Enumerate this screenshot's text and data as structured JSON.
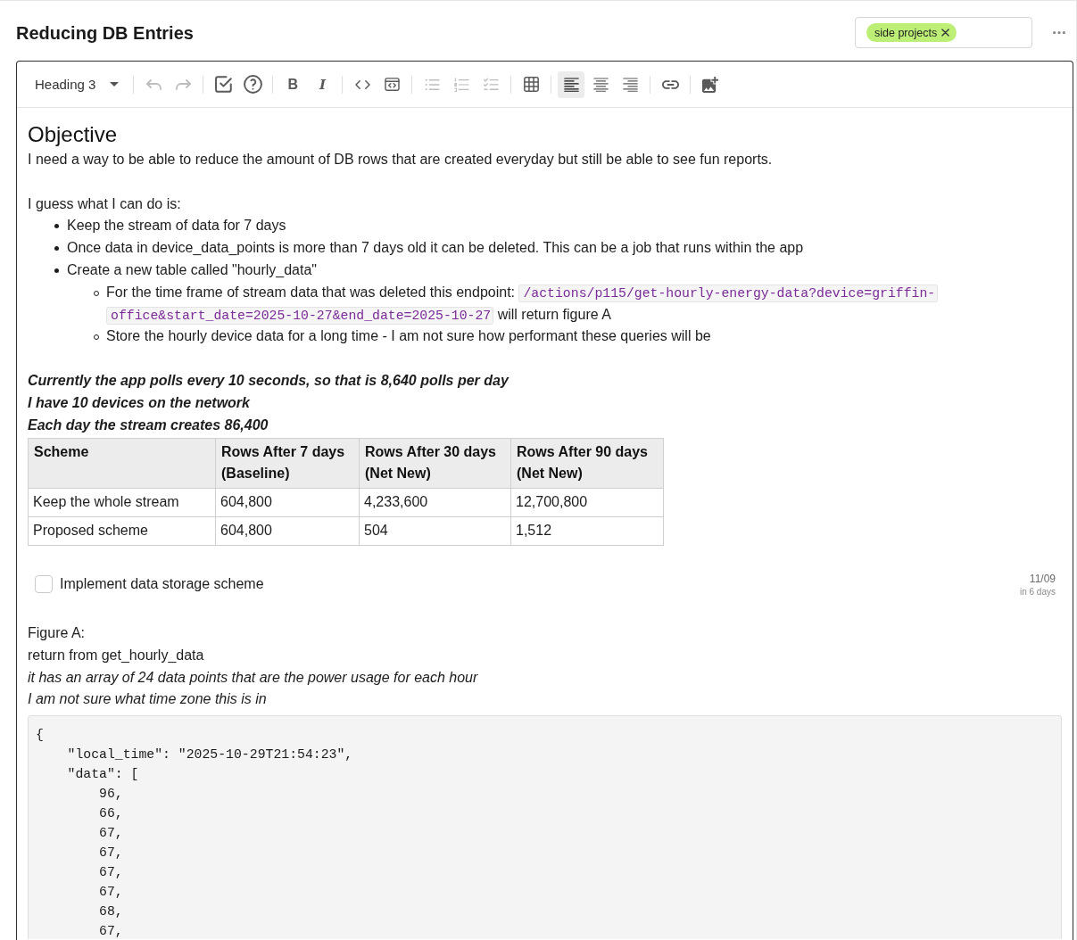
{
  "header": {
    "title": "Reducing DB Entries",
    "tags": [
      {
        "label": "side projects"
      }
    ]
  },
  "toolbar": {
    "block_style": "Heading 3",
    "groups": [
      [
        {
          "kind": "undo",
          "disabled": true
        },
        {
          "kind": "redo",
          "disabled": true
        }
      ],
      [
        {
          "kind": "task",
          "disabled": false
        },
        {
          "kind": "help",
          "disabled": false
        }
      ],
      [
        {
          "kind": "bold",
          "glyph": "B",
          "disabled": false
        },
        {
          "kind": "italic",
          "glyph": "I",
          "disabled": false
        }
      ],
      [
        {
          "kind": "code",
          "disabled": false
        },
        {
          "kind": "code_block",
          "disabled": false
        }
      ],
      [
        {
          "kind": "bullet_list",
          "disabled": true
        },
        {
          "kind": "numbered_list",
          "disabled": true
        },
        {
          "kind": "check_list",
          "disabled": true
        }
      ],
      [
        {
          "kind": "table",
          "disabled": false
        }
      ],
      [
        {
          "kind": "align_left",
          "disabled": false,
          "selected": true
        },
        {
          "kind": "align_center",
          "disabled": false,
          "selected": false
        },
        {
          "kind": "align_right",
          "disabled": false,
          "selected": false
        }
      ],
      [
        {
          "kind": "link",
          "disabled": false
        }
      ],
      [
        {
          "kind": "image",
          "disabled": false
        }
      ]
    ]
  },
  "document": {
    "sections": [
      [
        {
          "kind": "heading",
          "text": "Objective"
        },
        {
          "kind": "paragraph",
          "text": "I need a way to be able to reduce the amount of DB rows that are created everyday but still be able to see fun reports."
        }
      ],
      [
        {
          "kind": "paragraph",
          "text": "I guess what I can do is:"
        },
        {
          "kind": "list",
          "items": [
            {
              "parts": [
                {
                  "kind": "text",
                  "text": "Keep the stream of data for 7 days"
                }
              ]
            },
            {
              "parts": [
                {
                  "kind": "text",
                  "text": "Once data in device_data_points is more than 7 days old it can be deleted. This can be a job that runs within the app"
                }
              ]
            },
            {
              "parts": [
                {
                  "kind": "text",
                  "text": "Create a new table called \"hourly_data\""
                }
              ],
              "children": [
                {
                  "parts": [
                    {
                      "kind": "text",
                      "text": "For the time frame of stream data that was deleted this endpoint:"
                    },
                    {
                      "kind": "code",
                      "text": "/actions/p115/get-hourly-energy-data?device=griffin-"
                    },
                    {
                      "kind": "code",
                      "text": "office&start_date=2025-10-27&end_date=2025-10-27"
                    },
                    {
                      "kind": "text",
                      "text": "will return figure A"
                    }
                  ]
                },
                {
                  "parts": [
                    {
                      "kind": "text",
                      "text": "Store the hourly device data for a long time - I am not sure how performant these queries will be"
                    }
                  ]
                }
              ]
            }
          ]
        }
      ],
      [
        {
          "kind": "bold_italic_paragraph",
          "text": "Currently the app polls every 10 seconds, so that is 8,640 polls per day"
        },
        {
          "kind": "bold_italic_paragraph",
          "text": "I have 10 devices on the network"
        },
        {
          "kind": "bold_italic_paragraph",
          "text": "Each day the stream creates 86,400"
        },
        {
          "kind": "table",
          "columns": [
            "Scheme",
            "Rows After 7 days (Baseline)",
            "Rows After 30 days (Net New)",
            "Rows After 90 days (Net New)"
          ],
          "rows": [
            [
              "Keep the whole stream",
              "604,800",
              "4,233,600",
              "12,700,800"
            ],
            [
              "Proposed scheme",
              "604,800",
              "504",
              "1,512"
            ]
          ]
        }
      ],
      [
        {
          "kind": "task",
          "label": "Implement data storage scheme",
          "checked": false,
          "due_date": "11/09",
          "due_in": "in 6 days"
        }
      ],
      [
        {
          "kind": "paragraph",
          "text": "Figure A:"
        },
        {
          "kind": "paragraph",
          "text": "return from get_hourly_data"
        },
        {
          "kind": "italic_paragraph",
          "text": "it has an array of 24 data points that are the power usage for each hour"
        },
        {
          "kind": "italic_paragraph",
          "text": "I am not sure what time zone this is in"
        },
        {
          "kind": "code_block",
          "lines": [
            "{",
            "    \"local_time\": \"2025-10-29T21:54:23\",",
            "    \"data\": [",
            "        96,",
            "        66,",
            "        67,",
            "        67,",
            "        67,",
            "        67,",
            "        68,",
            "        67,"
          ]
        }
      ]
    ]
  }
}
